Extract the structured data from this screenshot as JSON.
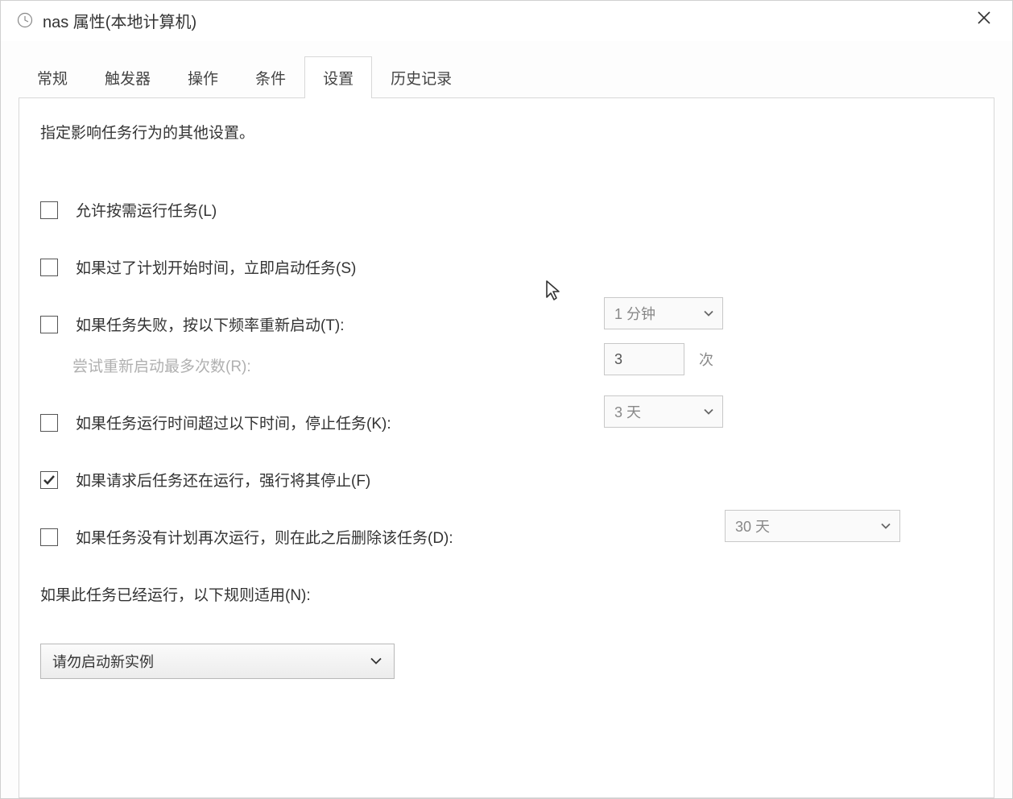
{
  "title": "nas 属性(本地计算机)",
  "tabs": {
    "general": "常规",
    "triggers": "触发器",
    "actions": "操作",
    "conditions": "条件",
    "settings": "设置",
    "history": "历史记录"
  },
  "description": "指定影响任务行为的其他设置。",
  "settings": {
    "allow_on_demand": {
      "label": "允许按需运行任务(L)",
      "checked": false
    },
    "run_asap": {
      "label": "如果过了计划开始时间，立即启动任务(S)",
      "checked": false
    },
    "restart_on_fail": {
      "label": "如果任务失败，按以下频率重新启动(T):",
      "checked": false,
      "interval": "1 分钟"
    },
    "restart_attempts": {
      "label": "尝试重新启动最多次数(R):",
      "value": "3",
      "suffix": "次"
    },
    "stop_if_runs_longer": {
      "label": "如果任务运行时间超过以下时间，停止任务(K):",
      "checked": false,
      "value": "3 天"
    },
    "force_stop": {
      "label": "如果请求后任务还在运行，强行将其停止(F)",
      "checked": true
    },
    "delete_if_not_scheduled": {
      "label": "如果任务没有计划再次运行，则在此之后删除该任务(D):",
      "checked": false,
      "value": "30 天"
    },
    "already_running_label": "如果此任务已经运行，以下规则适用(N):",
    "rule_value": "请勿启动新实例"
  }
}
